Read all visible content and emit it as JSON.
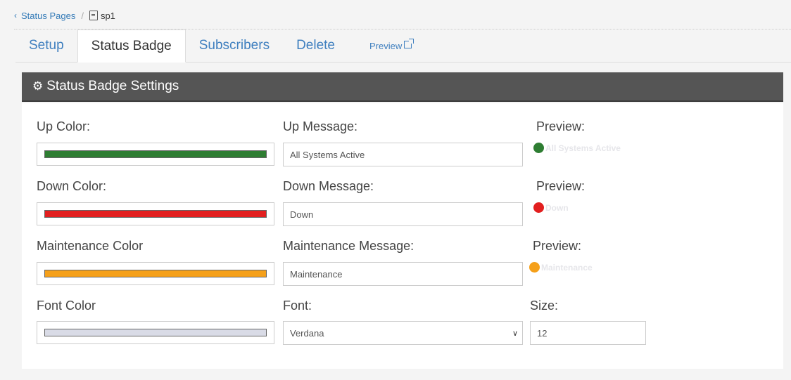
{
  "breadcrumb": {
    "parent": "Status Pages",
    "current": "sp1"
  },
  "tabs": [
    {
      "label": "Setup"
    },
    {
      "label": "Status Badge"
    },
    {
      "label": "Subscribers"
    },
    {
      "label": "Delete"
    }
  ],
  "preview_link": "Preview",
  "panel": {
    "title": "Status Badge Settings"
  },
  "rows": [
    {
      "color_label": "Up Color:",
      "color": "#2e7d32",
      "message_label": "Up Message:",
      "message": "All Systems Active",
      "preview_label": "Preview:",
      "preview_text": "All Systems Active"
    },
    {
      "color_label": "Down Color:",
      "color": "#e21f1f",
      "message_label": "Down Message:",
      "message": "Down",
      "preview_label": "Preview:",
      "preview_text": "Down"
    },
    {
      "color_label": "Maintenance Color",
      "color": "#f5a01a",
      "message_label": "Maintenance Message:",
      "message": "Maintenance",
      "preview_label": "Preview:",
      "preview_text": "Maintenance"
    }
  ],
  "font_row": {
    "color_label": "Font Color",
    "color": "#d9dbe6",
    "font_label": "Font:",
    "font": "Verdana",
    "size_label": "Size:",
    "size": "12"
  }
}
